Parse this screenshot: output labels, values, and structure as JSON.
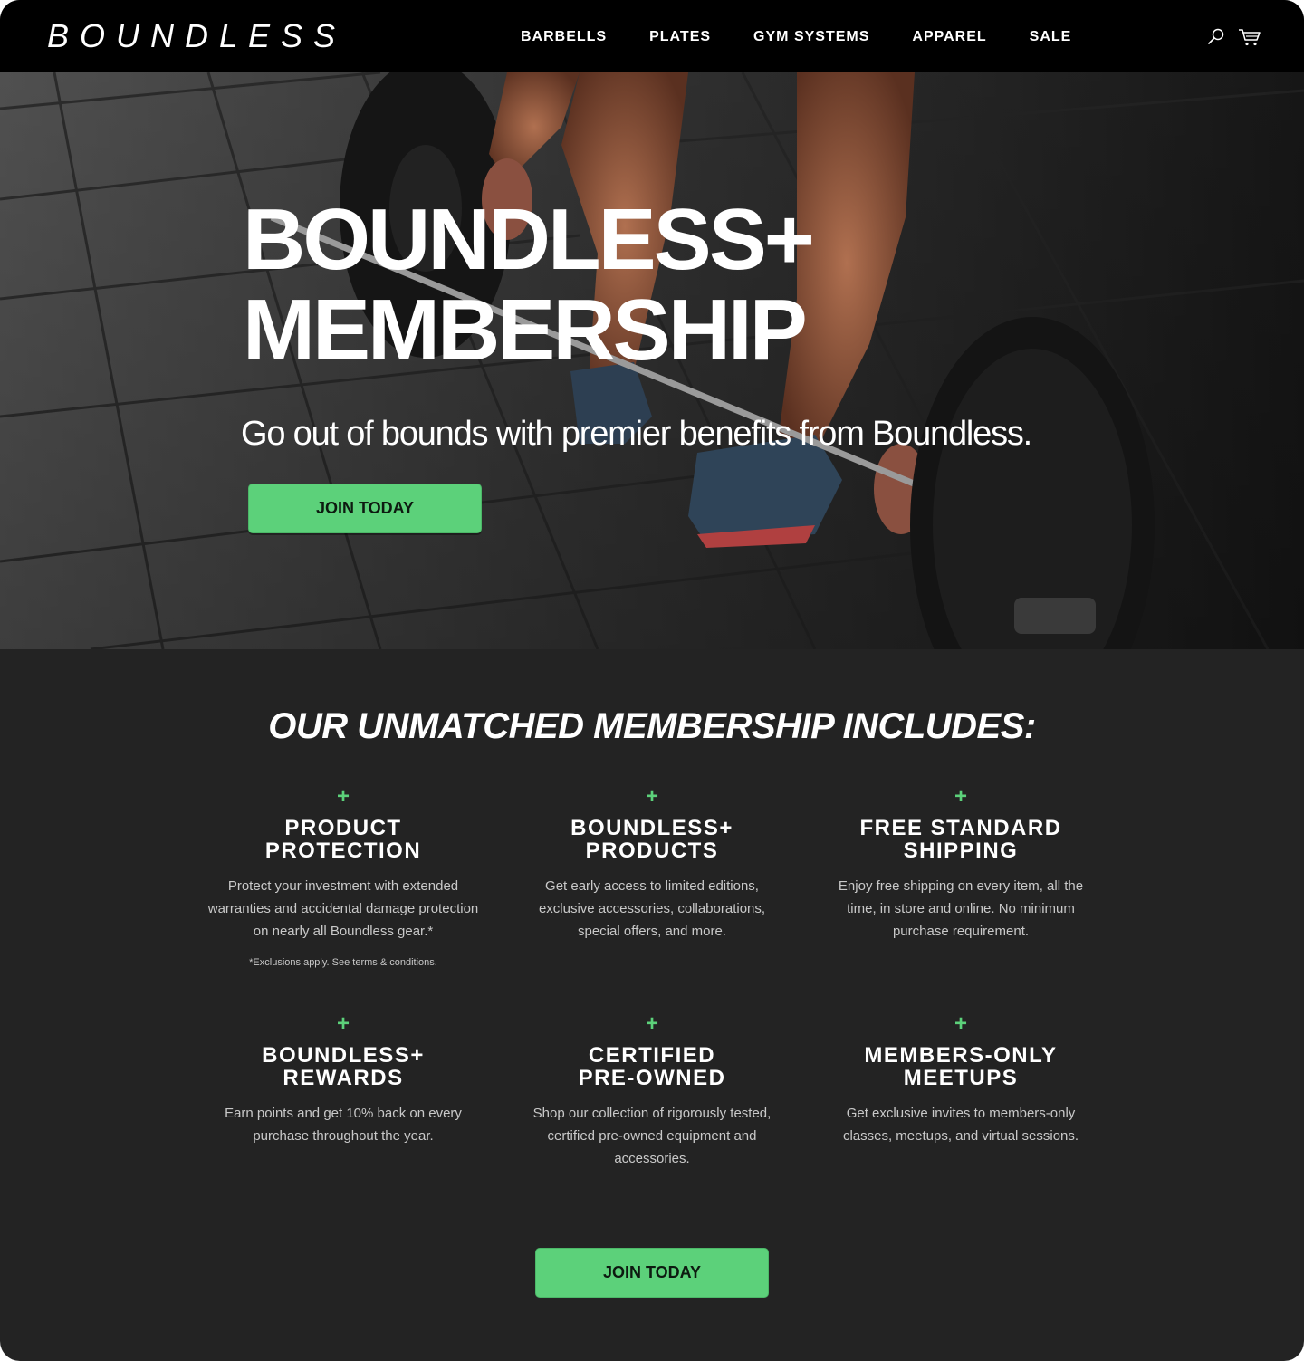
{
  "brand": {
    "logo": "BOUNDLESS"
  },
  "nav": {
    "items": [
      {
        "label": "BARBELLS"
      },
      {
        "label": "PLATES"
      },
      {
        "label": "GYM SYSTEMS"
      },
      {
        "label": "APPAREL"
      },
      {
        "label": "SALE"
      }
    ],
    "icons": [
      "search-icon",
      "cart-icon"
    ]
  },
  "hero": {
    "title_line1": "BOUNDLESS+",
    "title_line2": "MEMBERSHIP",
    "subtitle": "Go out of bounds with premier benefits from Boundless.",
    "cta": "JOIN TODAY"
  },
  "benefits": {
    "heading": "OUR UNMATCHED MEMBERSHIP INCLUDES:",
    "plus_symbol": "+",
    "items": [
      {
        "title_line1": "PRODUCT",
        "title_line2": "PROTECTION",
        "description": "Protect your investment with extended warranties and accidental damage protection on nearly all Boundless gear.*",
        "note": "*Exclusions apply. See terms & conditions."
      },
      {
        "title_line1": "BOUNDLESS+",
        "title_line2": "PRODUCTS",
        "description": "Get early access to limited editions, exclusive accessories, collaborations, special offers, and more."
      },
      {
        "title_line1": "FREE STANDARD",
        "title_line2": "SHIPPING",
        "description": "Enjoy free shipping on every item, all the time, in store and online. No minimum purchase requirement."
      },
      {
        "title_line1": "BOUNDLESS+",
        "title_line2": "REWARDS",
        "description": "Earn points and get 10% back on every purchase throughout the year."
      },
      {
        "title_line1": "CERTIFIED",
        "title_line2": "PRE-OWNED",
        "description": "Shop our collection of rigorously tested, certified pre-owned equipment and accessories."
      },
      {
        "title_line1": "MEMBERS-ONLY",
        "title_line2": "MEETUPS",
        "description": "Get exclusive invites to members-only classes, meetups, and virtual sessions."
      }
    ],
    "cta": "JOIN TODAY"
  },
  "colors": {
    "accent_green": "#5cd17a",
    "header_bg": "#000000",
    "section_bg": "#232323"
  }
}
